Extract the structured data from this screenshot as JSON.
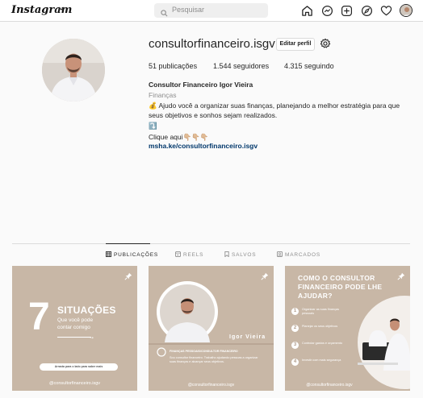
{
  "topbar": {
    "logo": "Instagram",
    "search_placeholder": "Pesquisar",
    "nav_icons": [
      "home-icon",
      "messenger-icon",
      "new-post-icon",
      "explore-icon",
      "heart-icon",
      "profile-avatar"
    ]
  },
  "profile": {
    "username": "consultorfinanceiro.isgv",
    "edit_label": "Editar perfil",
    "posts_count": "51",
    "posts_label": "publicações",
    "followers_count": "1.544",
    "followers_label": "seguidores",
    "following_count": "4.315",
    "following_label": "seguindo",
    "full_name": "Consultor Financeiro Igor Vieira",
    "category": "Finanças",
    "bio_line1": "💰 Ajudo você a organizar suas finanças, planejando a melhor estratégia para que seus objetivos e sonhos sejam realizados.",
    "bio_line2": "⤵️",
    "bio_line3": "Clique aqui👇🏼👇🏼👇🏼",
    "link": "msha.ke/consultorfinanceiro.isgv"
  },
  "tabs": [
    {
      "label": "PUBLICAÇÕES",
      "icon": "grid-icon",
      "active": true
    },
    {
      "label": "REELS",
      "icon": "reels-icon",
      "active": false
    },
    {
      "label": "SALVOS",
      "icon": "bookmark-icon",
      "active": false
    },
    {
      "label": "MARCADOS",
      "icon": "tagged-icon",
      "active": false
    }
  ],
  "posts": [
    {
      "big_number": "7",
      "headline": "SITUAÇÕES",
      "subtitle": "Que você pode contar comigo",
      "cta": "Arrasta para o lado para saber mais",
      "handle": "@consultorfinanceiro.isgv"
    },
    {
      "name": "Igor Vieira",
      "role": "FINANÇAS PESSOAIS/CONSULTOR FINANCEIRO",
      "body": "Sou consultor financeiro. Trabalho ajudando pessoas a organizar suas finanças e alcançar seus objetivos.",
      "handle": "@consultorfinanceiro.isgv"
    },
    {
      "headline": "COMO O CONSULTOR FINANCEIRO PODE LHE AJUDAR?",
      "items": [
        "1",
        "2",
        "3",
        "4"
      ],
      "texts": [
        "Organizar as suas finanças pessoais",
        "Planejar os seus objetivos",
        "Controlar gastos e orçamento",
        "Investir com mais segurança"
      ],
      "handle": "@consultorfinanceiro.isgv"
    }
  ],
  "colors": {
    "link": "#00376b",
    "muted": "#8e8e8e",
    "post_bg": "#c9b8a7",
    "post_dark": "#aa9888"
  }
}
